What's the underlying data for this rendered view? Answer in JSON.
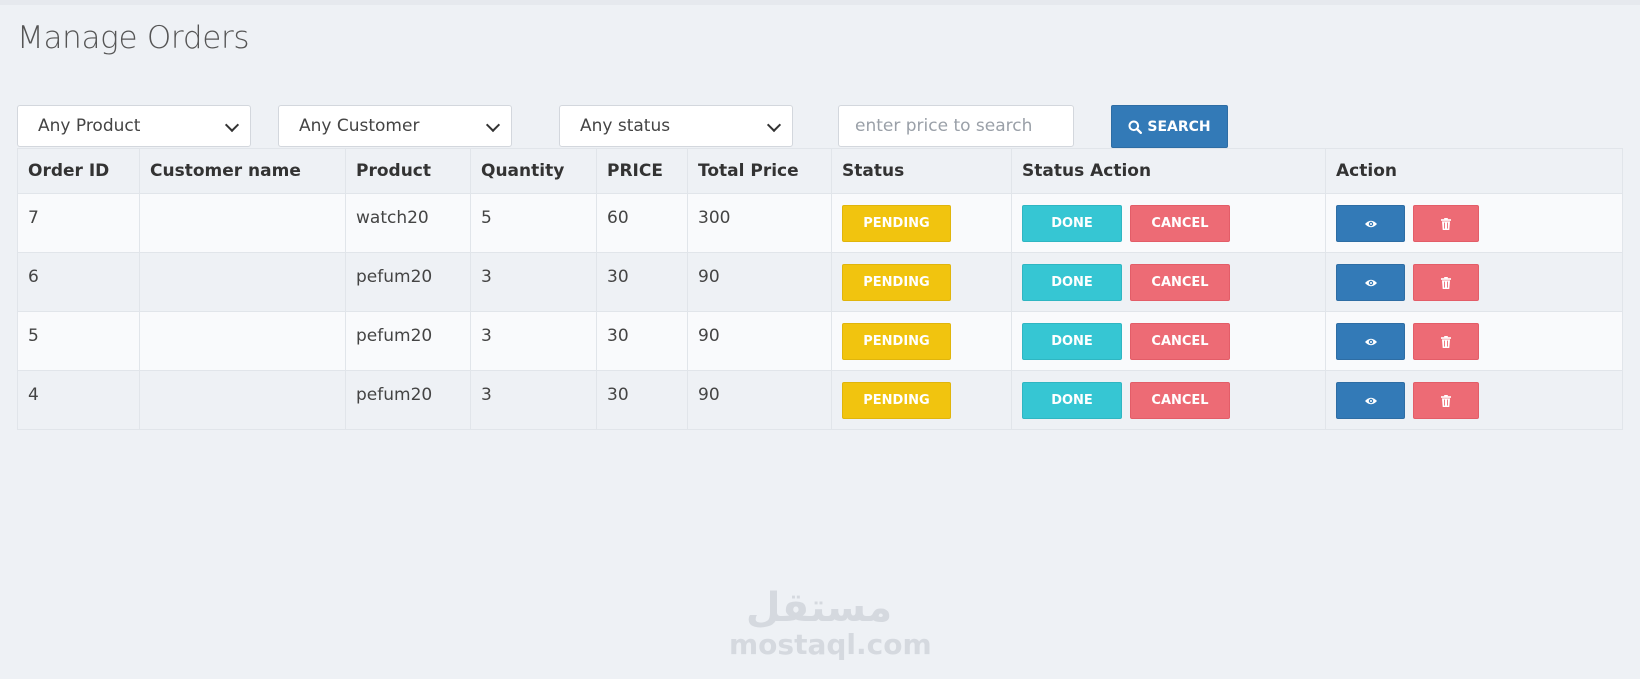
{
  "page": {
    "title": "Manage Orders"
  },
  "filters": {
    "product": "Any Product",
    "customer": "Any Customer",
    "status": "Any status",
    "price_placeholder": "enter price to search",
    "search_label": "SEARCH"
  },
  "table": {
    "headers": [
      "Order ID",
      "Customer name",
      "Product",
      "Quantity",
      "PRICE",
      "Total Price",
      "Status",
      "Status Action",
      "Action"
    ],
    "rows": [
      {
        "id": "7",
        "customer": "",
        "product": "watch20",
        "quantity": "5",
        "price": "60",
        "total": "300",
        "status": "PENDING"
      },
      {
        "id": "6",
        "customer": "",
        "product": "pefum20",
        "quantity": "3",
        "price": "30",
        "total": "90",
        "status": "PENDING"
      },
      {
        "id": "5",
        "customer": "",
        "product": "pefum20",
        "quantity": "3",
        "price": "30",
        "total": "90",
        "status": "PENDING"
      },
      {
        "id": "4",
        "customer": "",
        "product": "pefum20",
        "quantity": "3",
        "price": "30",
        "total": "90",
        "status": "PENDING"
      }
    ],
    "done_label": "DONE",
    "cancel_label": "CANCEL"
  },
  "icons": {
    "search": "search-icon",
    "view": "eye-icon",
    "delete": "trash-icon"
  },
  "colors": {
    "primary": "#337ab7",
    "pending": "#f1c40f",
    "done": "#36c6d3",
    "cancel": "#ed6b75"
  },
  "watermark": {
    "arabic": "مستقل",
    "latin": "mostaql.com"
  }
}
